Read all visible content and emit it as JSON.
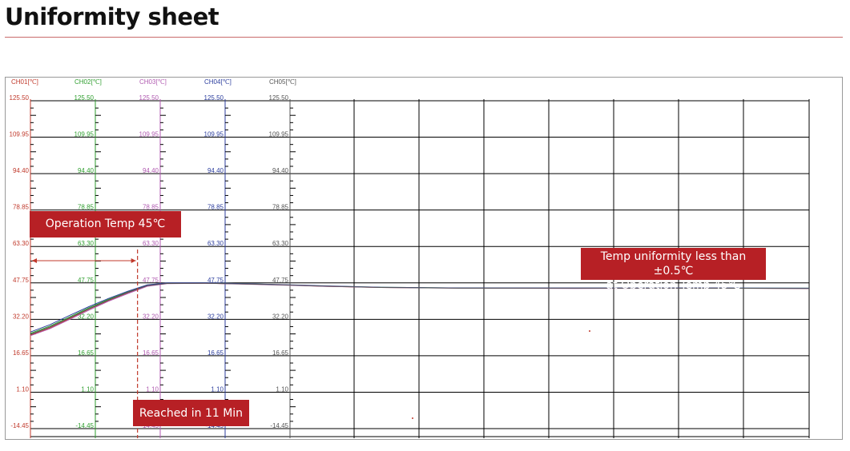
{
  "page": {
    "title": "Uniformity sheet"
  },
  "callouts": {
    "operation_temp": "Operation Temp 45℃",
    "reached": "Reached in 11 Min",
    "uniformity_line1": "Temp uniformity less than ±0.5℃",
    "uniformity_line2": "at Operation Temp 45℃"
  },
  "colors": {
    "ch01": "#c0392b",
    "ch02": "#2e9e2e",
    "ch03": "#b05ab0",
    "ch04": "#2c3e9e",
    "ch05": "#555555",
    "callout": "#b72025",
    "marker": "#c0392b"
  },
  "chart_data": {
    "type": "line",
    "channels": [
      "CH01[℃]",
      "CH02[℃]",
      "CH03[℃]",
      "CH04[℃]",
      "CH05[℃]"
    ],
    "y_ticks": [
      "125.50",
      "109.95",
      "94.40",
      "78.85",
      "63.30",
      "47.75",
      "32.20",
      "16.65",
      "1.10",
      "-14.45"
    ],
    "ylim": [
      -14.45,
      125.5
    ],
    "xlim": [
      0,
      80
    ],
    "grid": true,
    "marker_time": 11,
    "series": [
      {
        "channel": "CH01",
        "color": "#c0392b",
        "points": [
          [
            0,
            25.5
          ],
          [
            2,
            28.5
          ],
          [
            4,
            32.5
          ],
          [
            6,
            36.5
          ],
          [
            8,
            40.2
          ],
          [
            10,
            43.5
          ],
          [
            12,
            46.5
          ],
          [
            14,
            47.5
          ],
          [
            18,
            47.6
          ],
          [
            22,
            47.3
          ],
          [
            26,
            46.9
          ],
          [
            30,
            46.3
          ],
          [
            36,
            45.8
          ],
          [
            44,
            45.6
          ],
          [
            56,
            45.5
          ],
          [
            70,
            45.5
          ],
          [
            80,
            45.4
          ]
        ]
      },
      {
        "channel": "CH02",
        "color": "#2e9e2e",
        "points": [
          [
            0,
            26.2
          ],
          [
            2,
            29.3
          ],
          [
            4,
            33.2
          ],
          [
            6,
            37.1
          ],
          [
            8,
            40.7
          ],
          [
            10,
            43.9
          ],
          [
            12,
            46.7
          ],
          [
            14,
            47.6
          ],
          [
            18,
            47.7
          ],
          [
            22,
            47.4
          ],
          [
            26,
            46.9
          ],
          [
            30,
            46.4
          ],
          [
            36,
            45.9
          ],
          [
            44,
            45.6
          ],
          [
            56,
            45.5
          ],
          [
            70,
            45.5
          ],
          [
            80,
            45.5
          ]
        ]
      },
      {
        "channel": "CH03",
        "color": "#b05ab0",
        "points": [
          [
            0,
            25.2
          ],
          [
            2,
            28.2
          ],
          [
            4,
            32.1
          ],
          [
            6,
            36.1
          ],
          [
            8,
            39.9
          ],
          [
            10,
            43.2
          ],
          [
            12,
            46.3
          ],
          [
            14,
            47.4
          ],
          [
            18,
            47.6
          ],
          [
            22,
            47.2
          ],
          [
            26,
            46.8
          ],
          [
            30,
            46.3
          ],
          [
            36,
            45.8
          ],
          [
            44,
            45.5
          ],
          [
            56,
            45.4
          ],
          [
            70,
            45.5
          ],
          [
            80,
            45.4
          ]
        ]
      },
      {
        "channel": "CH04",
        "color": "#2c3e9e",
        "points": [
          [
            0,
            26.8
          ],
          [
            2,
            29.9
          ],
          [
            4,
            33.8
          ],
          [
            6,
            37.6
          ],
          [
            8,
            41.1
          ],
          [
            10,
            44.2
          ],
          [
            12,
            46.9
          ],
          [
            14,
            47.7
          ],
          [
            18,
            47.8
          ],
          [
            22,
            47.4
          ],
          [
            26,
            47.0
          ],
          [
            30,
            46.5
          ],
          [
            36,
            45.9
          ],
          [
            44,
            45.6
          ],
          [
            56,
            45.6
          ],
          [
            70,
            45.6
          ],
          [
            80,
            45.5
          ]
        ]
      },
      {
        "channel": "CH05",
        "color": "#555555",
        "points": [
          [
            0,
            25.8
          ],
          [
            2,
            28.9
          ],
          [
            4,
            32.8
          ],
          [
            6,
            36.7
          ],
          [
            8,
            40.4
          ],
          [
            10,
            43.7
          ],
          [
            12,
            46.6
          ],
          [
            14,
            47.5
          ],
          [
            18,
            47.6
          ],
          [
            22,
            47.3
          ],
          [
            26,
            46.9
          ],
          [
            30,
            46.4
          ],
          [
            36,
            45.8
          ],
          [
            44,
            45.5
          ],
          [
            56,
            45.5
          ],
          [
            70,
            45.5
          ],
          [
            80,
            45.4
          ]
        ]
      }
    ]
  }
}
